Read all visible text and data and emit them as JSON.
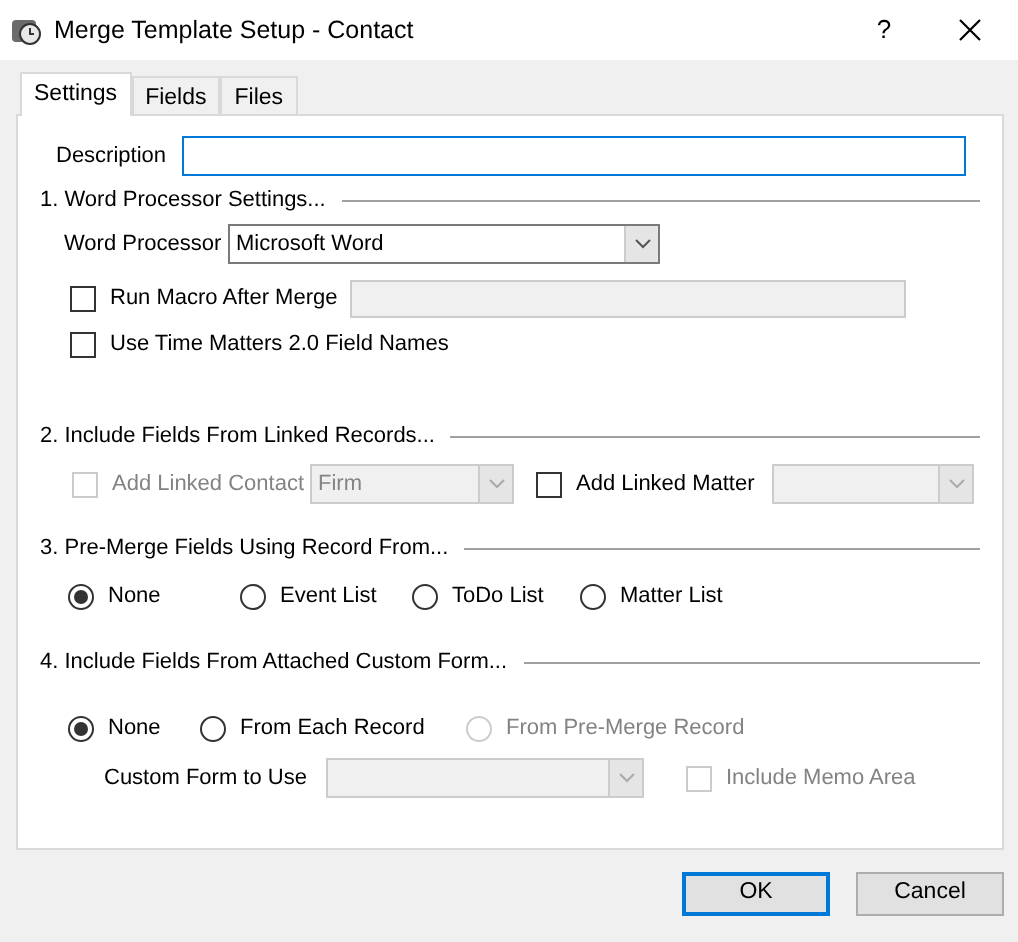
{
  "window": {
    "title": "Merge Template Setup - Contact",
    "help": "?"
  },
  "tabs": [
    {
      "label": "Settings",
      "selected": true
    },
    {
      "label": "Fields",
      "selected": false
    },
    {
      "label": "Files",
      "selected": false
    }
  ],
  "description": {
    "label": "Description",
    "focused": true
  },
  "sections": [
    {
      "heading": "1. Word Processor Settings...",
      "rows": [
        [
          {
            "kind": "label",
            "text": "Word Processor"
          },
          {
            "kind": "select",
            "value": "Microsoft Word",
            "disabled": false
          }
        ],
        [
          {
            "kind": "checkbox",
            "label": "Run Macro After Merge",
            "checked": false,
            "disabled": false
          },
          {
            "kind": "field",
            "disabled": true
          }
        ],
        [
          {
            "kind": "checkbox",
            "label": "Use Time Matters 2.0 Field Names",
            "checked": false,
            "disabled": false
          }
        ]
      ]
    },
    {
      "heading": "2. Include Fields From Linked Records...",
      "rows": [
        [
          {
            "kind": "checkbox",
            "label": "Add Linked Contact",
            "checked": false,
            "disabled": true
          },
          {
            "kind": "select",
            "value": "Firm",
            "disabled": true
          },
          {
            "kind": "checkbox",
            "label": "Add Linked Matter",
            "checked": false,
            "disabled": false
          },
          {
            "kind": "select",
            "disabled": true
          }
        ]
      ]
    },
    {
      "heading": "3. Pre-Merge Fields Using Record From...",
      "rows": [
        [
          {
            "kind": "radio",
            "label": "None",
            "selected": true,
            "disabled": false
          },
          {
            "kind": "radio",
            "label": "Event List",
            "selected": false,
            "disabled": false
          },
          {
            "kind": "radio",
            "label": "ToDo List",
            "selected": false,
            "disabled": false
          },
          {
            "kind": "radio",
            "label": "Matter List",
            "selected": false,
            "disabled": false
          }
        ]
      ]
    },
    {
      "heading": "4. Include Fields From Attached Custom Form...",
      "rows": [
        [
          {
            "kind": "radio",
            "label": "None",
            "selected": true,
            "disabled": false
          },
          {
            "kind": "radio",
            "label": "From Each Record",
            "selected": false,
            "disabled": false
          },
          {
            "kind": "radio",
            "label": "From Pre-Merge Record",
            "selected": false,
            "disabled": true
          }
        ],
        [
          {
            "kind": "label",
            "text": "Custom Form to Use"
          },
          {
            "kind": "select",
            "disabled": true
          },
          {
            "kind": "checkbox",
            "label": "Include Memo Area",
            "checked": false,
            "disabled": true
          }
        ]
      ]
    }
  ],
  "buttons": [
    {
      "label": "OK",
      "default": true
    },
    {
      "label": "Cancel",
      "default": false
    }
  ]
}
